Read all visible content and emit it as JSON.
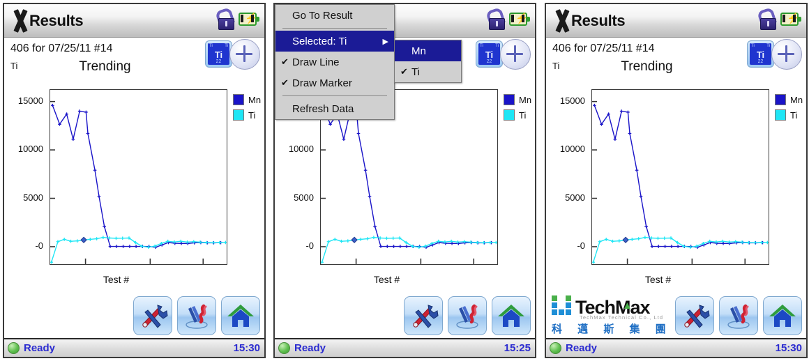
{
  "app": {
    "title": "Results",
    "logo_icon": "x-logo-icon",
    "lock_icon": "unlocked-padlock-icon",
    "battery_icon": "battery-charging-icon"
  },
  "panels": [
    {
      "id": "left",
      "header": {
        "result_line": "406 for 07/25/11 #14",
        "element_symbol": "Ti",
        "chart_title": "Trending",
        "element_button": {
          "symbol": "Ti",
          "number": "22",
          "corner_left": "Ti",
          "corner_right": "Ti"
        },
        "add_button_icon": "plus-circle-icon"
      },
      "status": {
        "text": "Ready",
        "time": "15:30",
        "dot": "ready-indicator"
      },
      "show_logo": false,
      "show_menu": false
    },
    {
      "id": "middle",
      "header": {
        "result_line": "406 for 07/25/11 #14",
        "element_symbol": "Ti",
        "chart_title": "Trending",
        "element_button": {
          "symbol": "Ti",
          "number": "22",
          "corner_left": "Ti",
          "corner_right": "Ti"
        },
        "add_button_icon": "plus-circle-icon"
      },
      "status": {
        "text": "Ready",
        "time": "15:25",
        "dot": "ready-indicator"
      },
      "show_logo": false,
      "show_menu": true
    },
    {
      "id": "right",
      "header": {
        "result_line": "406 for 07/25/11 #14",
        "element_symbol": "Ti",
        "chart_title": "Trending",
        "element_button": {
          "symbol": "Ti",
          "number": "22",
          "corner_left": "Ti",
          "corner_right": "Ti"
        },
        "add_button_icon": "plus-circle-icon"
      },
      "status": {
        "text": "Ready",
        "time": "15:30",
        "dot": "ready-indicator"
      },
      "show_logo": true,
      "show_menu": false
    }
  ],
  "context_menu": {
    "items": [
      {
        "label": "Go To Result",
        "checked": false,
        "highlighted": false,
        "submenu": false
      },
      {
        "label": "Selected: Ti",
        "checked": false,
        "highlighted": true,
        "submenu": true
      },
      {
        "label": "Draw Line",
        "checked": true,
        "highlighted": false,
        "submenu": false
      },
      {
        "label": "Draw Marker",
        "checked": true,
        "highlighted": false,
        "submenu": false
      },
      {
        "label": "Refresh Data",
        "checked": false,
        "highlighted": false,
        "submenu": false
      }
    ],
    "submenu_items": [
      {
        "label": "Mn",
        "checked": false,
        "highlighted": true
      },
      {
        "label": "Ti",
        "checked": true,
        "highlighted": false
      }
    ],
    "check_glyph": "✔",
    "arrow_glyph": "▶"
  },
  "toolbar": {
    "buttons": [
      {
        "name": "tools-button",
        "icon": "wrench-screwdriver-icon"
      },
      {
        "name": "analysis-button",
        "icon": "test-probe-icon"
      },
      {
        "name": "home-button",
        "icon": "home-icon"
      }
    ]
  },
  "brand": {
    "name_part1": "Tech",
    "name_part2": "Max",
    "tagline": "TechMax Technical Co., Ltd",
    "chinese": "科 邁 斯 集 團"
  },
  "colors": {
    "mn": "#1a14c8",
    "ti": "#1ee6f5",
    "menu_highlight": "#1b1b96",
    "status_text": "#2b2bd0"
  },
  "chart_data": {
    "type": "line",
    "title": "Trending",
    "xlabel": "Test #",
    "ylabel": "",
    "ylim": [
      -1800,
      16200
    ],
    "yticks": [
      15000,
      10000,
      5000,
      0
    ],
    "ytick_labels": [
      "15000",
      "10000",
      "5000",
      "-0"
    ],
    "xlim": [
      0,
      30
    ],
    "xticks": [
      6,
      17,
      26
    ],
    "xtick_labels": [
      "",
      "",
      ""
    ],
    "grid": false,
    "legend": [
      "Mn",
      "Ti"
    ],
    "legend_position": "right",
    "series": [
      {
        "name": "Mn",
        "color": "#1a14c8",
        "x": [
          0.4,
          1.6,
          2.8,
          3.9,
          5.0,
          6.1,
          6.4,
          7.6,
          8.3,
          9.2,
          10.2,
          11.3,
          12.4,
          13.5,
          14.6,
          15.7,
          16.8,
          17.9,
          19.0,
          20.1,
          21.2,
          22.3,
          23.4,
          24.5,
          25.6,
          26.7,
          27.8,
          29.0
        ],
        "y": [
          14600,
          12650,
          13700,
          11100,
          14000,
          13900,
          11700,
          7900,
          5200,
          2100,
          30,
          30,
          30,
          30,
          30,
          30,
          20,
          -60,
          180,
          430,
          350,
          340,
          330,
          400,
          430,
          400,
          400,
          420
        ]
      },
      {
        "name": "Ti",
        "color": "#1ee6f5",
        "x": [
          0.2,
          1.3,
          2.4,
          3.5,
          4.6,
          5.7,
          6.8,
          7.9,
          9.0,
          10.1,
          11.2,
          12.3,
          13.4,
          14.5,
          15.6,
          16.7,
          17.8,
          18.9,
          20.0,
          21.1,
          22.2,
          23.3,
          24.4,
          25.5,
          26.6,
          27.7,
          28.8,
          29.8
        ],
        "y": [
          -1600,
          520,
          760,
          560,
          600,
          700,
          760,
          820,
          960,
          900,
          870,
          880,
          900,
          430,
          40,
          -50,
          60,
          340,
          560,
          490,
          560,
          480,
          520,
          470,
          430,
          420,
          430,
          440
        ]
      }
    ]
  }
}
